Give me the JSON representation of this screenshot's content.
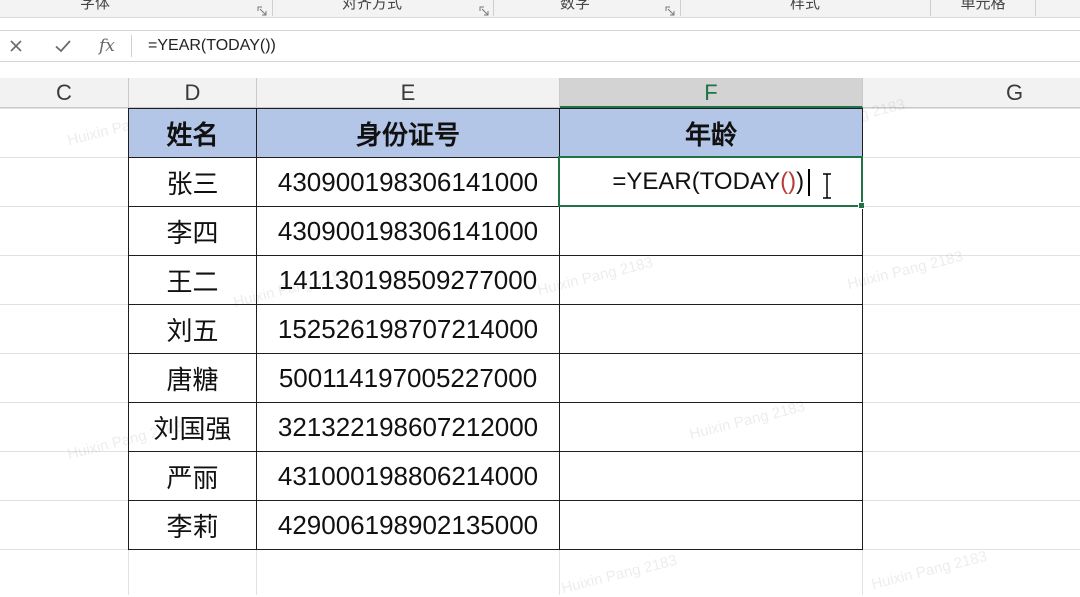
{
  "ribbon": {
    "groups": [
      {
        "label": "字体",
        "launcher": true
      },
      {
        "label": "对齐方式",
        "launcher": true
      },
      {
        "label": "数字",
        "launcher": true
      },
      {
        "label": "样式",
        "launcher": false
      },
      {
        "label": "单元格",
        "launcher": false
      }
    ]
  },
  "formula_bar": {
    "cancel_icon": "close-icon",
    "enter_icon": "check-icon",
    "function_icon": "fx",
    "formula": "=YEAR(TODAY())"
  },
  "column_headers": [
    "C",
    "D",
    "E",
    "F",
    "G"
  ],
  "table": {
    "headers": [
      "姓名",
      "身份证号",
      "年龄"
    ],
    "rows": [
      {
        "name": "张三",
        "id": "430900198306141000"
      },
      {
        "name": "李四",
        "id": "430900198306141000"
      },
      {
        "name": "王二",
        "id": "141130198509277000"
      },
      {
        "name": "刘五",
        "id": "152526198707214000"
      },
      {
        "name": "唐糖",
        "id": "500114197005227000"
      },
      {
        "name": "刘国强",
        "id": "321322198607212000"
      },
      {
        "name": "严丽",
        "id": "431000198806214000"
      },
      {
        "name": "李莉",
        "id": "429006198902135000"
      }
    ]
  },
  "active_cell": {
    "editing": true,
    "formula_parts": [
      "=YEAR(TODAY",
      "()",
      ")"
    ]
  },
  "colors": {
    "header_fill": "#b4c6e7",
    "accent": "#217346",
    "paren_highlight": "#b83b3b",
    "table_border": "#1e1e1e",
    "gridline": "#e1e1e1"
  },
  "watermark": "Huixin Pang 2183"
}
